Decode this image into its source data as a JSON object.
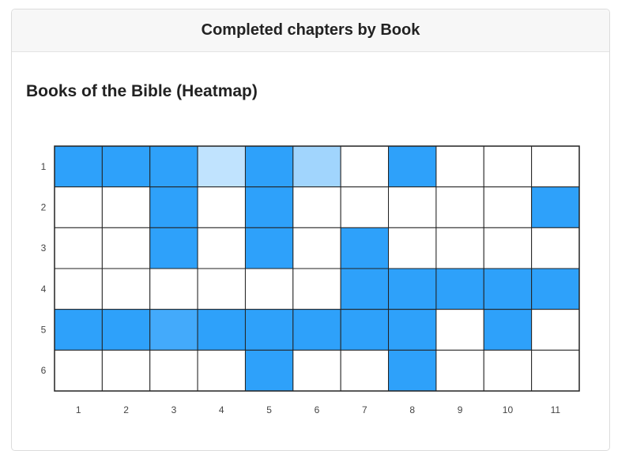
{
  "header": {
    "title": "Completed chapters by Book"
  },
  "chart_data": {
    "type": "heatmap",
    "title": "Books of the Bible (Heatmap)",
    "x_categories": [
      "1",
      "2",
      "3",
      "4",
      "5",
      "6",
      "7",
      "8",
      "9",
      "10",
      "11"
    ],
    "y_categories": [
      "1",
      "2",
      "3",
      "4",
      "5",
      "6"
    ],
    "values": [
      [
        1,
        1,
        1,
        0.3,
        1,
        0.45,
        0,
        1,
        0,
        0,
        0
      ],
      [
        0,
        0,
        1,
        0,
        1,
        0,
        0,
        0,
        0,
        0,
        1
      ],
      [
        0,
        0,
        1,
        0,
        1,
        0,
        1,
        0,
        0,
        0,
        0
      ],
      [
        0,
        0,
        0,
        0,
        0,
        0,
        1,
        1,
        1,
        1,
        1
      ],
      [
        1,
        1,
        0.9,
        1,
        1,
        1,
        1,
        1,
        0,
        1,
        0
      ],
      [
        0,
        0,
        0,
        0,
        1,
        0,
        0,
        1,
        0,
        0,
        0
      ]
    ],
    "value_range": [
      0,
      1
    ],
    "colors": {
      "high": "#2ea1fa",
      "low": "#ffffff",
      "grid": "#222222"
    },
    "grid": true,
    "legend": "none"
  }
}
